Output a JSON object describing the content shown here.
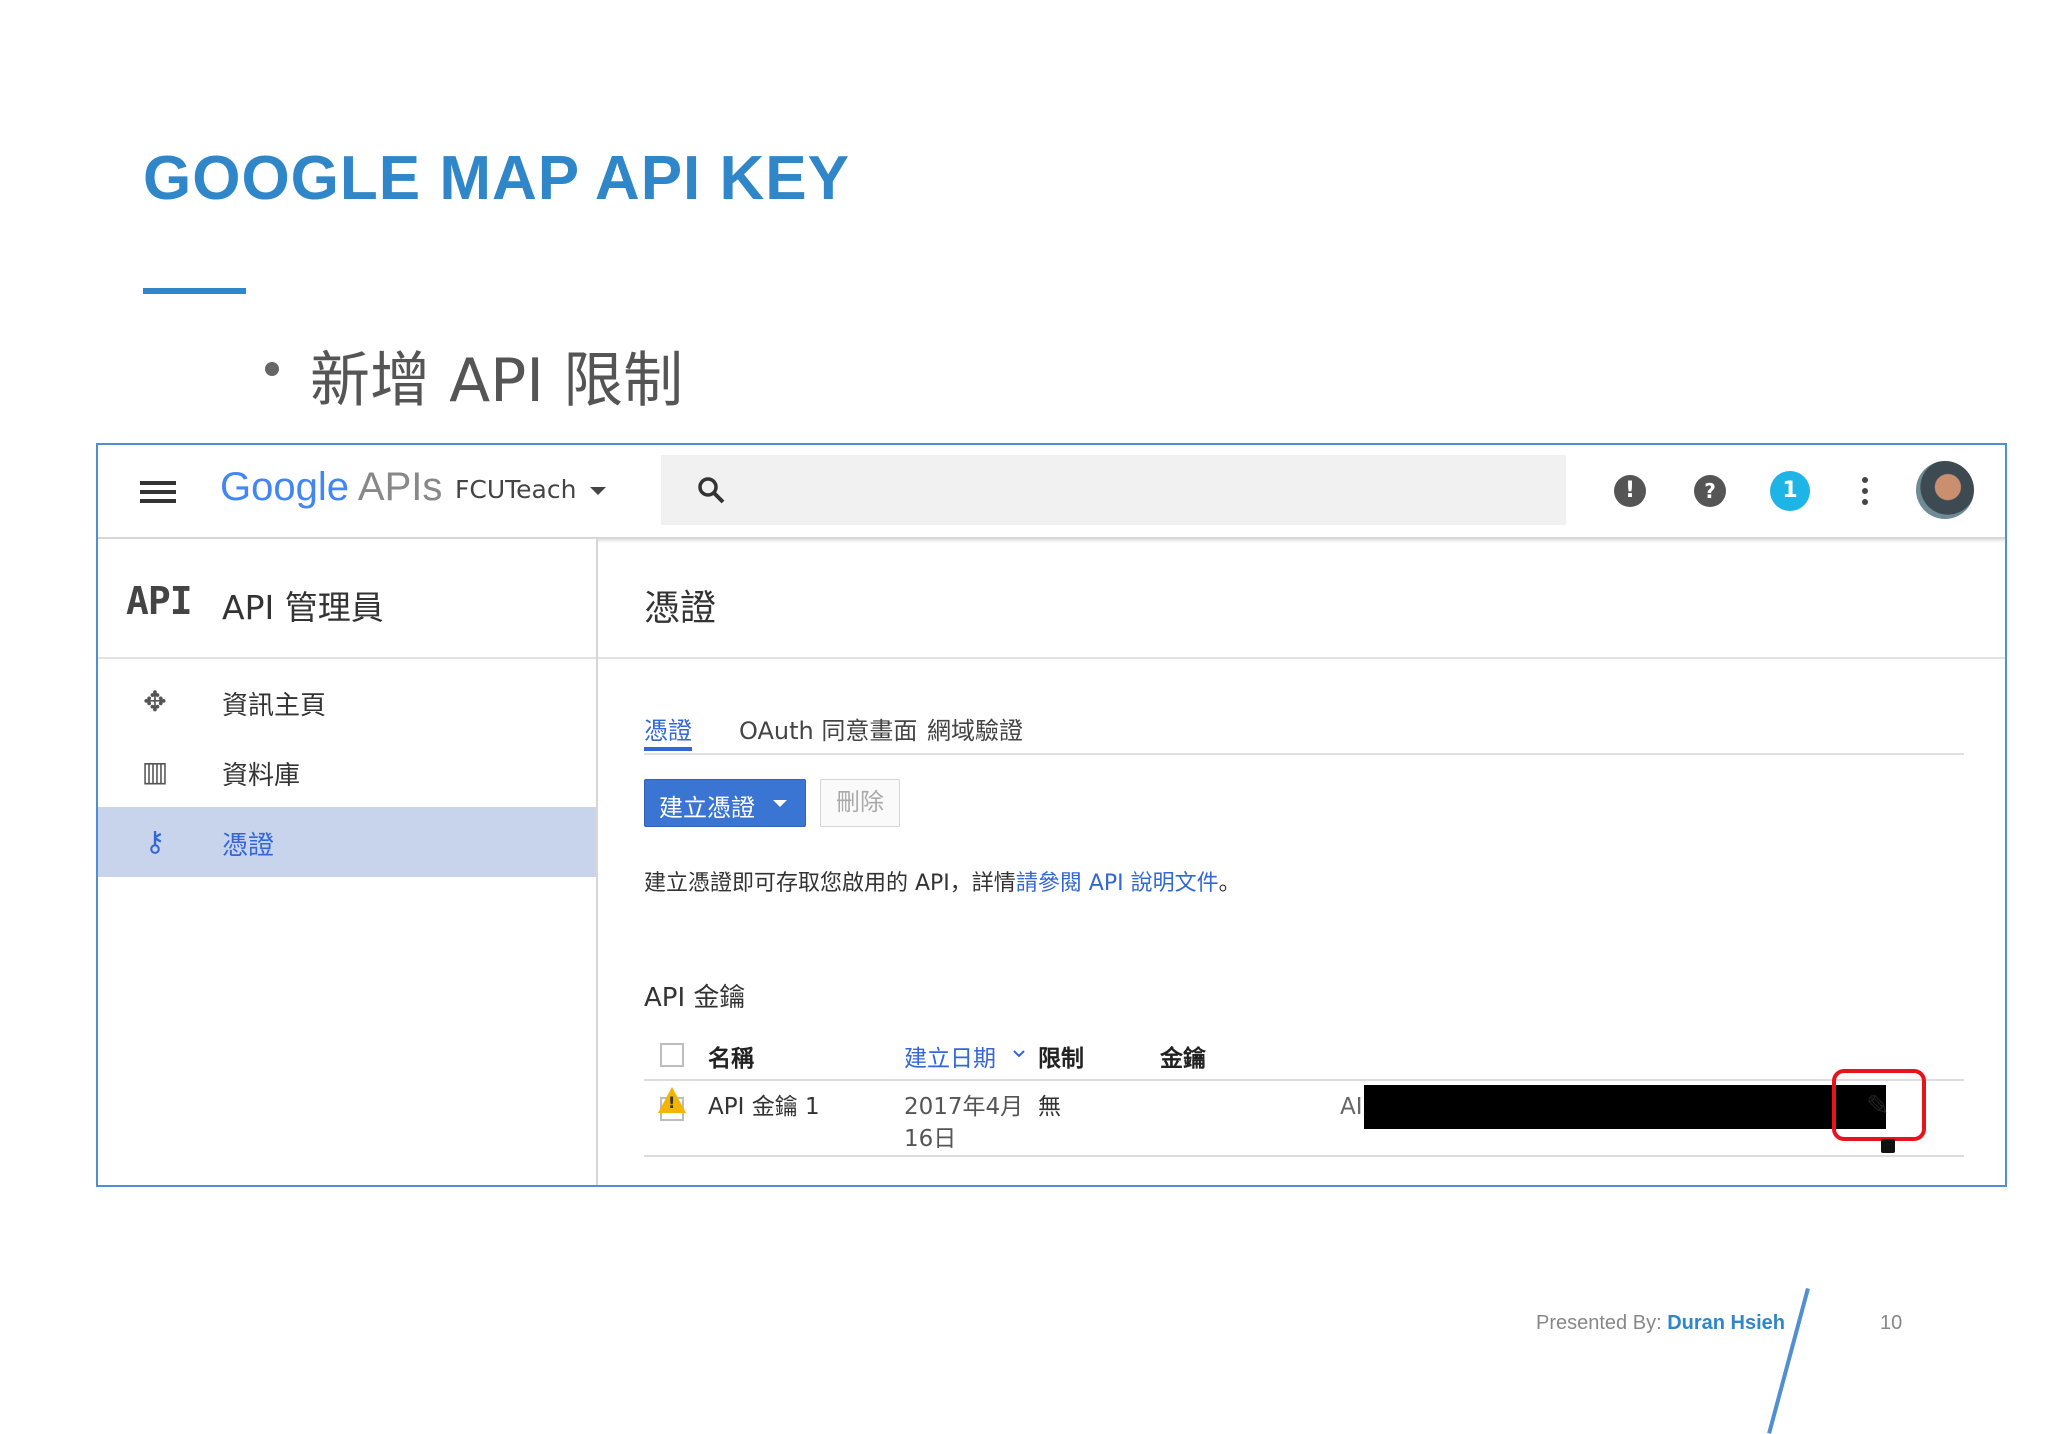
{
  "slide": {
    "title": "GOOGLE MAP API KEY",
    "bullet": "新增 API 限制",
    "presenter_prefix": "Presented By: ",
    "presenter_name": "Duran Hsieh",
    "page_number": "10"
  },
  "topbar": {
    "logo_google": "Google",
    "logo_apis": "APIs",
    "project": "FCUTeach",
    "notification_count": "1",
    "icons": [
      "menu-icon",
      "search-icon",
      "alert-icon",
      "help-icon",
      "notification-icon",
      "more-vert-icon",
      "avatar"
    ]
  },
  "sidebar": {
    "api_mark": "API",
    "title": "API 管理員",
    "items": [
      {
        "label": "資訊主頁",
        "icon": "dashboard-icon"
      },
      {
        "label": "資料庫",
        "icon": "library-icon"
      },
      {
        "label": "憑證",
        "icon": "key-icon",
        "active": true
      }
    ]
  },
  "main": {
    "page_title": "憑證",
    "tabs": [
      {
        "label": "憑證",
        "active": true
      },
      {
        "label": "OAuth 同意畫面"
      },
      {
        "label": "網域驗證"
      }
    ],
    "create_button": "建立憑證",
    "delete_button": "刪除",
    "info_text": "建立憑證即可存取您啟用的 API，詳情",
    "info_link": "請參閱 API 說明文件",
    "info_end": "。",
    "section_title": "API 金鑰",
    "table": {
      "headers": [
        "名稱",
        "建立日期",
        "限制",
        "金鑰"
      ],
      "rows": [
        {
          "name": "API 金鑰 1",
          "date_line1": "2017年4月",
          "date_line2": "16日",
          "restriction": "無",
          "key_prefix": "AI"
        }
      ]
    }
  },
  "colors": {
    "title_blue": "#2f86c8",
    "link_blue": "#3367d6",
    "highlight_red": "#e8141c",
    "active_row_bg": "#c8d3ec"
  }
}
